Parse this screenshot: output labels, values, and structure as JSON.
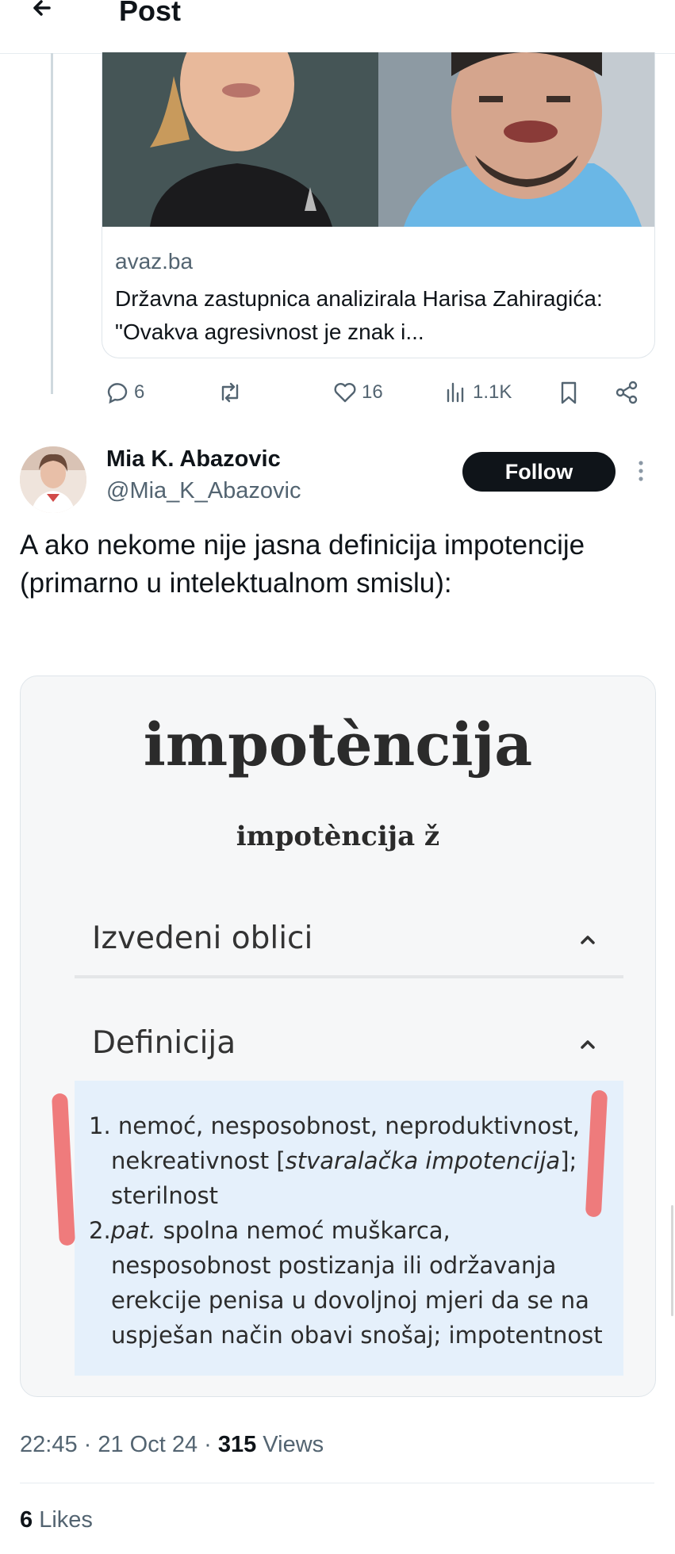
{
  "header": {
    "title": "Post"
  },
  "link_card": {
    "domain": "avaz.ba",
    "title": "Državna zastupnica analizirala Harisa Zahiragića: \"Ovakva agresivnost je znak i..."
  },
  "actions": {
    "replies": "6",
    "likes": "16",
    "views": "1.1K"
  },
  "tweet": {
    "display_name": "Mia K. Abazovic",
    "handle": "@Mia_K_Abazovic",
    "follow_label": "Follow",
    "text": "A ako nekome nije jasna definicija impotencije (primarno u intelektualnom smislu):",
    "timestamp": "22:45 · 21 Oct 24 · ",
    "views_count": "315",
    "views_label": " Views",
    "likes_count": "6",
    "likes_label": " Likes"
  },
  "dictionary": {
    "headword": "impotèncija",
    "subhead": "impotèncija ž",
    "sections": [
      "Izvedeni oblici",
      "Definicija"
    ],
    "definitions": {
      "l1_num": "1.",
      "l1_text": "nemoć, nesposobnost, neproduktivnost,",
      "l2_pre": "nekreativnost [",
      "l2_italic": "stvaralačka impotencija",
      "l2_post": "];",
      "l3": "sterilnost",
      "d2_num": "2.",
      "d2_pat": "pat.",
      "d2_text": " spolna nemoć muškarca,",
      "l5": "nesposobnost postizanja ili održavanja",
      "l6": "erekcije penisa u dovoljnoj mjeri da se na",
      "l7": "uspješan način obavi snošaj; impotentnost"
    }
  },
  "colors": {
    "accent_dark": "#0f1419",
    "secondary_text": "#536471",
    "def_bg": "#e5f0fb",
    "highlight": "#ee7475"
  }
}
